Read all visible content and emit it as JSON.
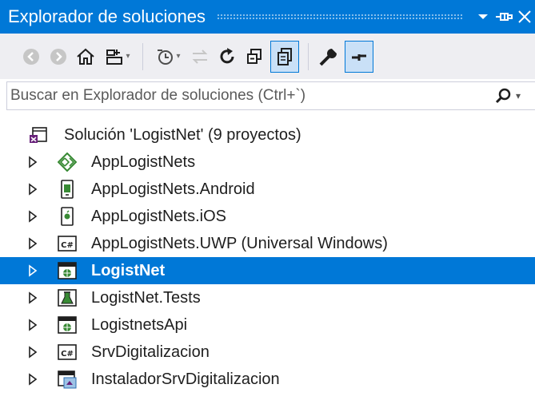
{
  "window": {
    "title": "Explorador de soluciones"
  },
  "search": {
    "placeholder": "Buscar en Explorador de soluciones (Ctrl+`)"
  },
  "toolbar": {
    "buttons": [
      "back-icon",
      "forward-icon",
      "home-icon",
      "switch-views-icon",
      "pending-changes-filter-icon",
      "sync-icon",
      "refresh-icon",
      "collapse-all-icon",
      "show-all-files-icon",
      "properties-icon",
      "preview-selected-icon"
    ]
  },
  "tree": {
    "solution": "Solución 'LogistNet'  (9 proyectos)",
    "projects": [
      {
        "label": "AppLogistNets",
        "icon": "shared-project-icon"
      },
      {
        "label": "AppLogistNets.Android",
        "icon": "android-project-icon"
      },
      {
        "label": "AppLogistNets.iOS",
        "icon": "ios-project-icon"
      },
      {
        "label": "AppLogistNets.UWP (Universal Windows)",
        "icon": "csharp-project-icon"
      },
      {
        "label": "LogistNet",
        "icon": "web-project-icon",
        "selected": true
      },
      {
        "label": "LogistNet.Tests",
        "icon": "test-project-icon"
      },
      {
        "label": "LogistnetsApi",
        "icon": "web-project-icon"
      },
      {
        "label": "SrvDigitalizacion",
        "icon": "csharp-project-icon"
      },
      {
        "label": "InstaladorSrvDigitalizacion",
        "icon": "setup-project-icon"
      }
    ]
  },
  "colors": {
    "accent": "#0078d7",
    "toolbar": "#eeeef2",
    "selected_text": "#ffffff"
  }
}
